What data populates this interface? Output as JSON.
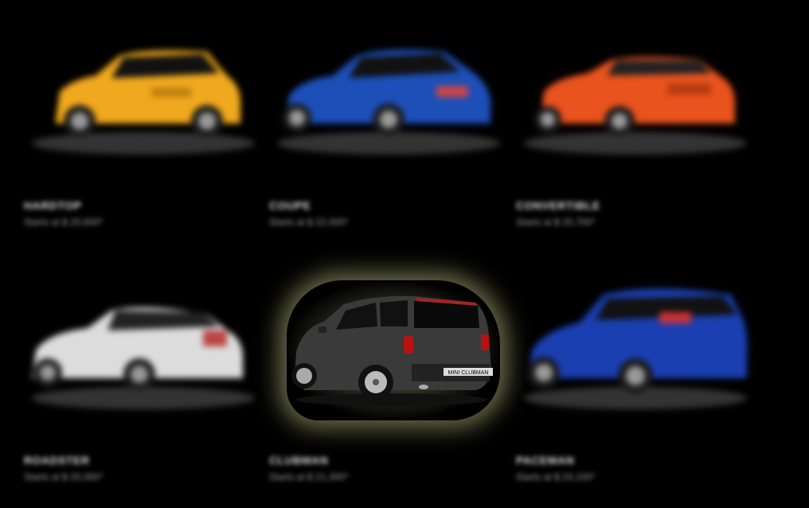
{
  "models": [
    {
      "name": "HARDTOP",
      "subtitle": "Starts at $ 20,600*",
      "color": "#f0a81e"
    },
    {
      "name": "COUPE",
      "subtitle": "Starts at $ 22,000*",
      "color": "#1d4fb8"
    },
    {
      "name": "CONVERTIBLE",
      "subtitle": "Starts at $ 25,700*",
      "color": "#e8531e"
    },
    {
      "name": "ROADSTER",
      "subtitle": "Starts at $ 25,050*",
      "color": "#dcdcdc"
    },
    {
      "name": "CLUBMAN",
      "subtitle": "Starts at $ 21,300*",
      "color": "#3a3a3a",
      "badge": "MINI CLUBMAN",
      "focused": true
    },
    {
      "name": "PACEMAN",
      "subtitle": "Starts at $ 24,100*",
      "color": "#1a3fb0"
    }
  ]
}
